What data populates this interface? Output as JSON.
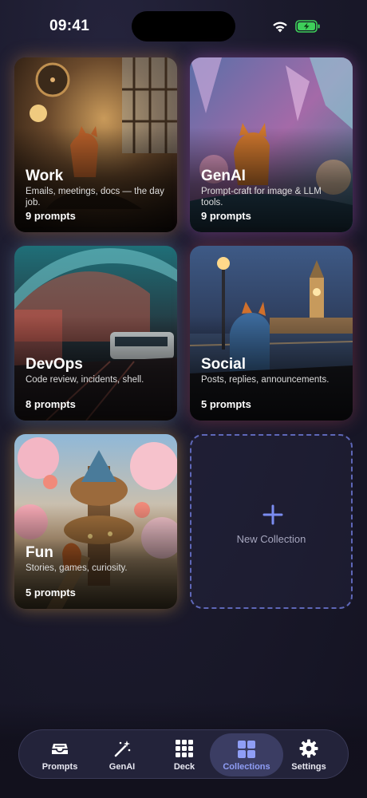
{
  "status_bar": {
    "time": "09:41",
    "icons": [
      "wifi-icon",
      "battery-charging-icon"
    ],
    "battery_color": "#3ecf5a"
  },
  "collections": [
    {
      "title": "Work",
      "description": "Emails, meetings, docs — the day job.",
      "count": "9 prompts",
      "image": "steampunk fox workshop"
    },
    {
      "title": "GenAI",
      "description": "Prompt-craft for image & LLM tools.",
      "count": "9 prompts",
      "image": "crystal garden fox"
    },
    {
      "title": "DevOps",
      "description": "Code review, incidents, shell.",
      "count": "8 prompts",
      "image": "futuristic train station"
    },
    {
      "title": "Social",
      "description": "Posts, replies, announcements.",
      "count": "5 prompts",
      "image": "fox overlooking Big Ben at night"
    },
    {
      "title": "Fun",
      "description": "Stories, games, curiosity.",
      "count": "5 prompts",
      "image": "fox treehouse with blossoms"
    }
  ],
  "new_collection": {
    "label": "New Collection",
    "icon": "plus-icon",
    "accent": "#7b8cf0"
  },
  "tabbar": {
    "items": [
      {
        "label": "Prompts",
        "icon": "inbox-tray-icon"
      },
      {
        "label": "GenAI",
        "icon": "magic-wand-icon"
      },
      {
        "label": "Deck",
        "icon": "grid-3x3-icon"
      },
      {
        "label": "Collections",
        "icon": "grid-2x2-icon",
        "active": true
      },
      {
        "label": "Settings",
        "icon": "gear-icon"
      }
    ],
    "active_color": "#8f9ef6"
  }
}
